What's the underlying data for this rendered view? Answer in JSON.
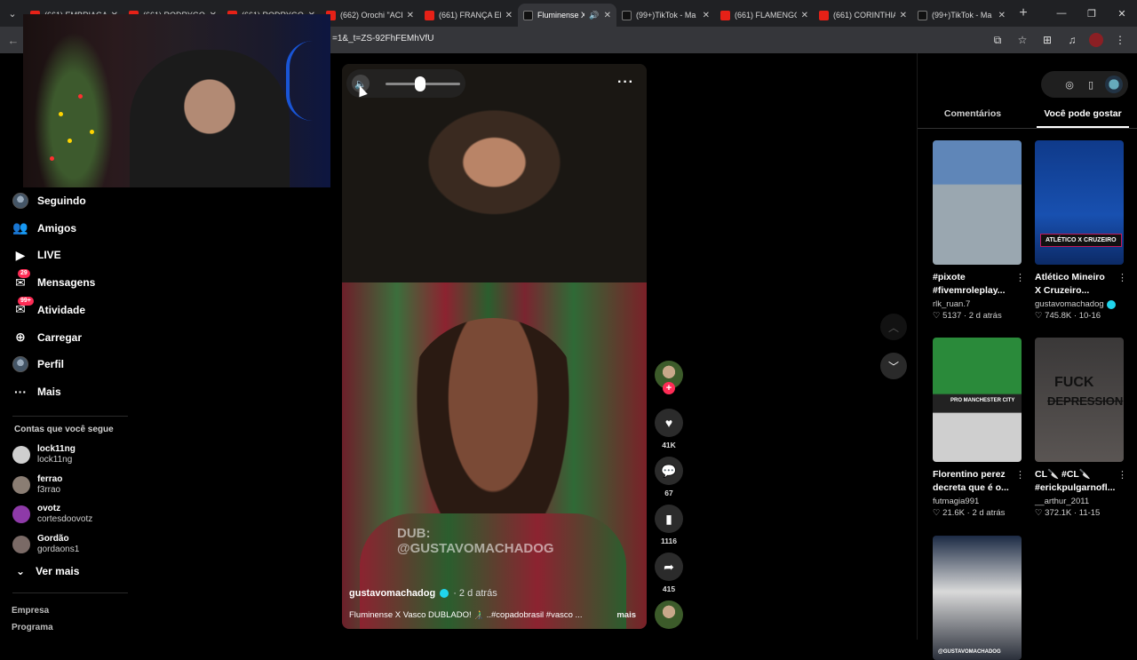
{
  "browser": {
    "tabs": [
      {
        "title": "(661) EMBRIAGAI",
        "favicon": "youtube",
        "active": false
      },
      {
        "title": "(661) RODRYGO",
        "favicon": "youtube",
        "active": false
      },
      {
        "title": "(661) RODRYGO E",
        "favicon": "youtube",
        "active": false
      },
      {
        "title": "(662) Orochi \"ACI",
        "favicon": "youtube",
        "active": false
      },
      {
        "title": "(661) FRANÇA EM",
        "favicon": "youtube",
        "active": false
      },
      {
        "title": "Fluminense X",
        "favicon": "tiktok",
        "active": true
      },
      {
        "title": "(99+)TikTok - Ma",
        "favicon": "tiktok",
        "active": false
      },
      {
        "title": "(661) FLAMENGO",
        "favicon": "youtube",
        "active": false
      },
      {
        "title": "(661) CORINTHIA",
        "favicon": "youtube",
        "active": false
      },
      {
        "title": "(99+)TikTok - Ma",
        "favicon": "tiktok",
        "active": false
      }
    ],
    "url": "=1&_t=ZS-92FhFEMhVfU"
  },
  "sidebar": {
    "nav": [
      {
        "label": "Seguindo",
        "icon": "following-avatar-icon"
      },
      {
        "label": "Amigos",
        "icon": "friends-icon"
      },
      {
        "label": "LIVE",
        "icon": "live-icon"
      },
      {
        "label": "Mensagens",
        "icon": "messages-icon",
        "badge": "29"
      },
      {
        "label": "Atividade",
        "icon": "activity-icon",
        "badge": "99+"
      },
      {
        "label": "Carregar",
        "icon": "upload-icon"
      },
      {
        "label": "Perfil",
        "icon": "profile-avatar-icon"
      },
      {
        "label": "Mais",
        "icon": "more-icon"
      }
    ],
    "following_title": "Contas que você segue",
    "following": [
      {
        "name": "lock11ng",
        "handle": "lock11ng",
        "color": "#cfcfcf"
      },
      {
        "name": "ferrao",
        "handle": "f3rrao",
        "color": "#8a7d73"
      },
      {
        "name": "ovotz",
        "handle": "cortesdoovotz",
        "color": "#8e3aa8"
      },
      {
        "name": "Gordão",
        "handle": "gordaons1",
        "color": "#7a6a66"
      }
    ],
    "see_more": "Ver mais",
    "footer": [
      "Empresa",
      "Programa"
    ]
  },
  "video": {
    "watermark_line1": "DUB:",
    "watermark_line2": "@GUSTAVOMACHADOG",
    "volume": 0.47,
    "author": "gustavomachadog",
    "posted": "· 2 d atrás",
    "caption": "Fluminense X Vasco DUBLADO! 👨‍🦯 ..#copadobrasil #vasco ...",
    "more_label": "mais",
    "stats": {
      "likes": "41K",
      "comments": "67",
      "saves": "1116",
      "shares": "415"
    }
  },
  "right_panel": {
    "tabs": [
      {
        "label": "Comentários",
        "active": false
      },
      {
        "label": "Você pode gostar",
        "active": true
      }
    ],
    "cards": [
      {
        "title": "#pixote #fivemroleplay...",
        "author": "rlk_ruan.7",
        "verified": false,
        "likes": "5137",
        "age": "2 d atrás",
        "thumb_label": ""
      },
      {
        "title": "Atlético Mineiro X Cruzeiro...",
        "author": "gustavomachadog",
        "verified": true,
        "likes": "745.8K",
        "age": "10-16",
        "thumb_label": "ATLÉTICO X CRUZEIRO"
      },
      {
        "title": "Florentino perez decreta que é o...",
        "author": "futmagia991",
        "verified": false,
        "likes": "21.6K",
        "age": "2 d atrás",
        "thumb_label": "PRO MANCHESTER CITY"
      },
      {
        "title": "CL🔪 #CL🔪 #erickpulgarnofl...",
        "author": "__arthur_2011",
        "verified": false,
        "likes": "372.1K",
        "age": "11-15",
        "thumb_text1": "FUCK",
        "thumb_text2": "DEPRESSION"
      },
      {
        "title": "",
        "author": "",
        "verified": false,
        "likes": "",
        "age": "",
        "thumb_label": "@GUSTAVOMACHADOG"
      }
    ]
  }
}
